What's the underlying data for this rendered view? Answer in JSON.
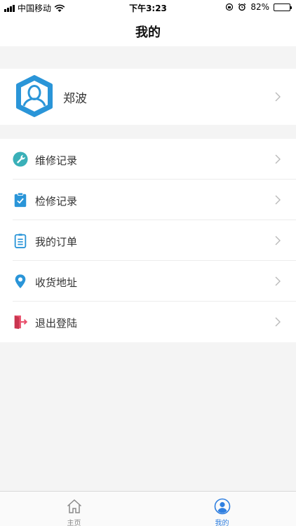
{
  "status_bar": {
    "carrier": "中国移动",
    "time": "下午3:23",
    "battery": "82%",
    "battery_level": 0.82
  },
  "nav": {
    "title": "我的"
  },
  "profile": {
    "name": "郑波"
  },
  "menu": [
    {
      "label": "维修记录",
      "icon": "wrench-icon"
    },
    {
      "label": "检修记录",
      "icon": "clipboard-check-icon"
    },
    {
      "label": "我的订单",
      "icon": "order-list-icon"
    },
    {
      "label": "收货地址",
      "icon": "location-pin-icon"
    },
    {
      "label": "退出登陆",
      "icon": "logout-door-icon"
    }
  ],
  "tabbar": {
    "home_label": "主页",
    "mine_label": "我的"
  },
  "colors": {
    "accent": "#2f7fe0",
    "avatar": "#2a95d8",
    "wrench": "#3ab0b8",
    "logout": "#e94f6b",
    "background": "#f4f4f4"
  }
}
